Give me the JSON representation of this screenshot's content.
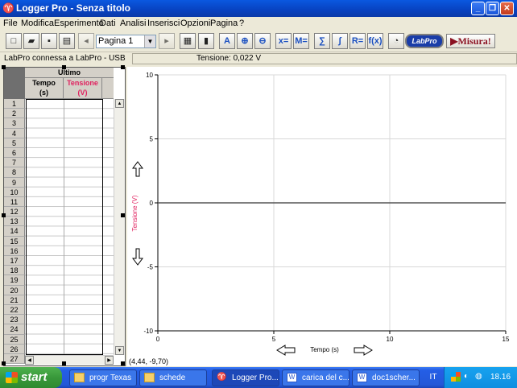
{
  "window": {
    "title": "Logger Pro - Senza titolo"
  },
  "menu": [
    "File",
    "Modifica",
    "Esperimento",
    "Dati",
    "Analisi",
    "Inserisci",
    "Opzioni",
    "Pagina",
    "?"
  ],
  "toolbar": {
    "page_select": "Pagina 1",
    "labpro_label": "LabPro",
    "collect_label": "Misura!"
  },
  "status": {
    "connection": "LabPro connessa a LabPro - USB",
    "meter": "Tensione: 0,022 V"
  },
  "table": {
    "dataset": "Ultimo",
    "columns": [
      {
        "name": "Tempo",
        "unit": "(s)"
      },
      {
        "name": "Tensione",
        "unit": "(V)"
      }
    ],
    "rows": [
      "1",
      "2",
      "3",
      "4",
      "5",
      "6",
      "7",
      "8",
      "9",
      "10",
      "11",
      "12",
      "13",
      "14",
      "15",
      "16",
      "17",
      "18",
      "19",
      "20",
      "21",
      "22",
      "23",
      "24",
      "25",
      "26",
      "27"
    ]
  },
  "graph": {
    "xlabel": "Tempo (s)",
    "ylabel": "Tensione (V)",
    "xlim": [
      0,
      15
    ],
    "ylim": [
      -10,
      10
    ],
    "x_ticks": [
      "0",
      "5",
      "10",
      "15"
    ],
    "y_ticks": [
      "10",
      "5",
      "0",
      "-5",
      "-10"
    ],
    "cursor_readout": "(4,44, -9,70)"
  },
  "taskbar": {
    "start_label": "start",
    "tasks": [
      {
        "label": "progr Texas",
        "icon": "folder-icon"
      },
      {
        "label": "schede",
        "icon": "folder-icon"
      },
      {
        "label": "Logger Pro...",
        "icon": "logger-pro-icon"
      },
      {
        "label": "carica del c...",
        "icon": "word-icon"
      },
      {
        "label": "doc1scher...",
        "icon": "word-icon"
      }
    ],
    "language": "IT",
    "clock": "18.16"
  }
}
